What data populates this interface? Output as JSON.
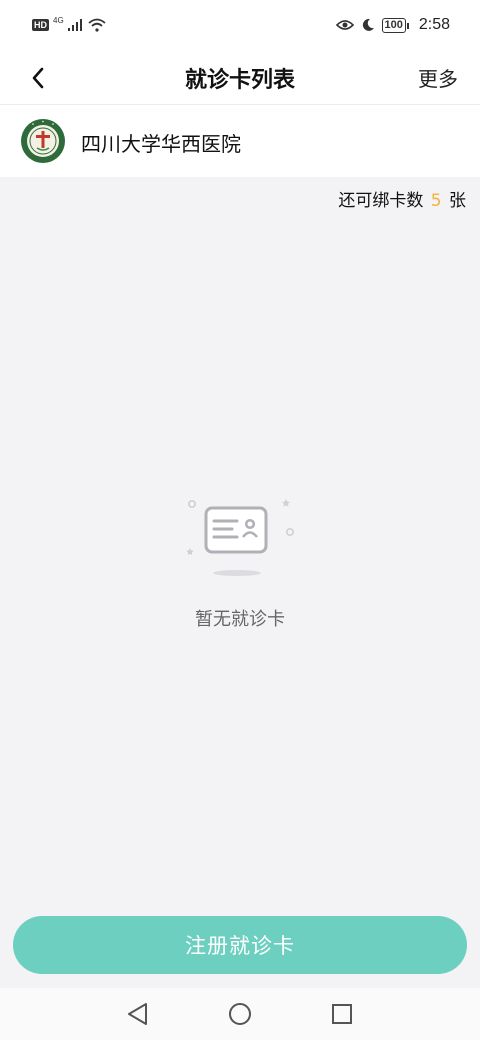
{
  "status_bar": {
    "hd": "HD",
    "network": "4G",
    "battery": "100",
    "time": "2:58"
  },
  "header": {
    "title": "就诊卡列表",
    "more_label": "更多"
  },
  "hospital": {
    "name": "四川大学华西医院"
  },
  "bind_info": {
    "prefix": "还可绑卡数",
    "count": "5",
    "suffix": "张"
  },
  "empty_state": {
    "text": "暂无就诊卡"
  },
  "register_button": {
    "label": "注册就诊卡"
  },
  "colors": {
    "accent": "#6dcfc0",
    "count_highlight": "#f4b23c",
    "background": "#f3f2f5"
  },
  "icons": {
    "back": "chevron-left-icon",
    "logo": "hospital-logo",
    "empty": "id-card-icon",
    "sys_back": "triangle-back-icon",
    "sys_home": "circle-home-icon",
    "sys_recent": "square-recent-icon"
  }
}
